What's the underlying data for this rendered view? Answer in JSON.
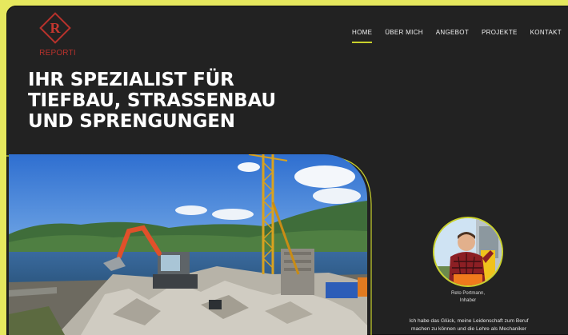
{
  "brand": {
    "logo_letter": "R",
    "logo_text": "REPORTI"
  },
  "nav": {
    "items": [
      {
        "label": "HOME",
        "active": true
      },
      {
        "label": "ÜBER MICH",
        "active": false
      },
      {
        "label": "ANGEBOT",
        "active": false
      },
      {
        "label": "PROJEKTE",
        "active": false
      },
      {
        "label": "KONTAKT",
        "active": false
      }
    ]
  },
  "hero": {
    "headline_lines": [
      "IHR SPEZIALIST FÜR",
      "TIEFBAU, STRASSENBAU",
      "UND SPRENGUNGEN"
    ]
  },
  "profile": {
    "name": "Reto Portmann,",
    "role": "Inhaber",
    "bio_lines": [
      "Ich habe das Glück, meine Leidenschaft zum Beruf",
      "machen zu können und die Lehre als Mechaniker"
    ]
  },
  "colors": {
    "accent": "#c9d12c",
    "brand_red": "#b8322c",
    "background": "#222222",
    "page_border": "#e6e85e"
  }
}
